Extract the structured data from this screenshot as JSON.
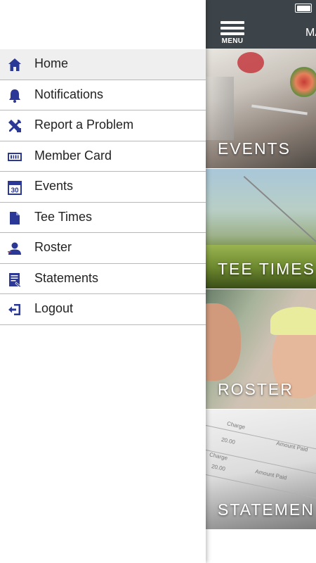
{
  "app": {
    "title": "MA",
    "menu_label": "MENU"
  },
  "drawer": {
    "items": [
      {
        "label": "Home",
        "icon": "home-icon"
      },
      {
        "label": "Notifications",
        "icon": "bell-icon"
      },
      {
        "label": "Report a Problem",
        "icon": "tools-icon"
      },
      {
        "label": "Member Card",
        "icon": "card-icon"
      },
      {
        "label": "Events",
        "icon": "calendar-icon"
      },
      {
        "label": "Tee Times",
        "icon": "document-icon"
      },
      {
        "label": "Roster",
        "icon": "person-icon"
      },
      {
        "label": "Statements",
        "icon": "statement-icon"
      },
      {
        "label": "Logout",
        "icon": "logout-icon"
      }
    ],
    "calendar_day": "30"
  },
  "tiles": [
    {
      "label": "EVENTS"
    },
    {
      "label": "TEE TIMES"
    },
    {
      "label": "ROSTER"
    },
    {
      "label": "STATEMEN"
    }
  ],
  "statement_bg": {
    "charge_1": "Charge",
    "amount_1": "Amount Paid",
    "charge_2": "Charge",
    "amount_2": "Amount Paid",
    "val_1": "20.00",
    "val_2": "20.00"
  },
  "colors": {
    "icon": "#2b3896",
    "appbar": "#3d4449",
    "active_item": "#efefef"
  }
}
